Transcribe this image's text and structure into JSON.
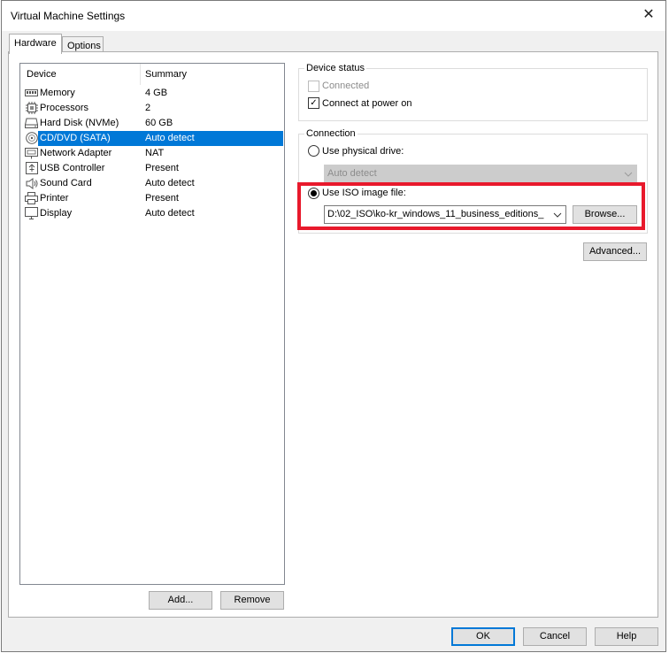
{
  "window": {
    "title": "Virtual Machine Settings",
    "close_glyph": "✕"
  },
  "tabs": [
    {
      "label": "Hardware"
    },
    {
      "label": "Options"
    }
  ],
  "device_list": {
    "headers": {
      "device": "Device",
      "summary": "Summary"
    },
    "rows": [
      {
        "icon": "memory-icon",
        "name": "Memory",
        "summary": "4 GB"
      },
      {
        "icon": "processor-icon",
        "name": "Processors",
        "summary": "2"
      },
      {
        "icon": "hard-disk-icon",
        "name": "Hard Disk (NVMe)",
        "summary": "60 GB"
      },
      {
        "icon": "cd-dvd-icon",
        "name": "CD/DVD (SATA)",
        "summary": "Auto detect"
      },
      {
        "icon": "network-adapter-icon",
        "name": "Network Adapter",
        "summary": "NAT"
      },
      {
        "icon": "usb-icon",
        "name": "USB Controller",
        "summary": "Present"
      },
      {
        "icon": "sound-card-icon",
        "name": "Sound Card",
        "summary": "Auto detect"
      },
      {
        "icon": "printer-icon",
        "name": "Printer",
        "summary": "Present"
      },
      {
        "icon": "display-icon",
        "name": "Display",
        "summary": "Auto detect"
      }
    ],
    "selected": "CD/DVD (SATA)"
  },
  "list_buttons": {
    "add": "Add...",
    "remove": "Remove"
  },
  "device_status": {
    "title": "Device status",
    "connected": {
      "label": "Connected",
      "checked": false,
      "enabled": false
    },
    "connect_at_power_on": {
      "label": "Connect at power on",
      "checked": true
    }
  },
  "connection": {
    "title": "Connection",
    "physical_drive": {
      "label": "Use physical drive:",
      "selected": false,
      "value": "Auto detect"
    },
    "iso_image": {
      "label": "Use ISO image file:",
      "selected": true,
      "value": "D:\\02_ISO\\ko-kr_windows_11_business_editions_"
    },
    "browse": "Browse...",
    "advanced": "Advanced..."
  },
  "footer": {
    "ok": "OK",
    "cancel": "Cancel",
    "help": "Help"
  },
  "colors": {
    "selection": "#0078d7",
    "highlight_box": "#e8192c"
  }
}
